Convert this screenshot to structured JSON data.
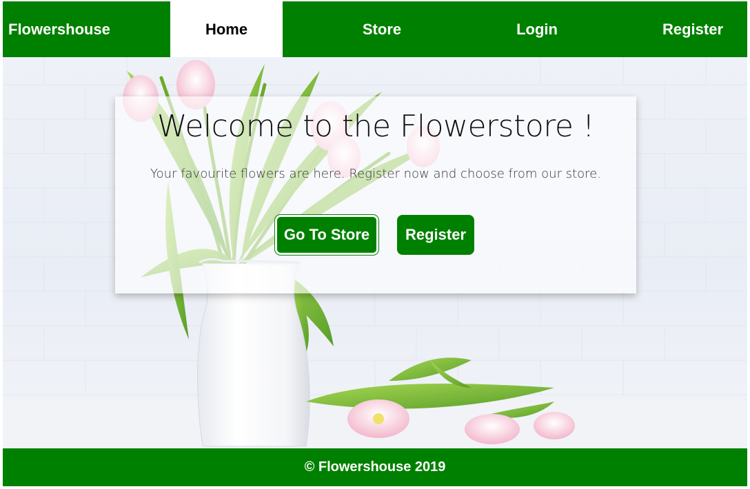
{
  "navbar": {
    "brand": "Flowershouse",
    "items": [
      {
        "label": "Home",
        "active": true
      },
      {
        "label": "Store"
      },
      {
        "label": "Login"
      },
      {
        "label": "Register"
      }
    ]
  },
  "hero": {
    "title": "Welcome to the Flowerstore !",
    "subtitle": "Your favourite flowers are here. Register now and choose from our store.",
    "buttons": {
      "store_label": "Go To Store",
      "register_label": "Register"
    }
  },
  "footer": {
    "text": "© Flowershouse 2019"
  },
  "colors": {
    "brand_green": "#008000",
    "nav_active_bg": "#ffffff",
    "text_on_green": "#ffffff"
  },
  "images": {
    "hero_background": "white-vase-with-pink-tulips"
  }
}
